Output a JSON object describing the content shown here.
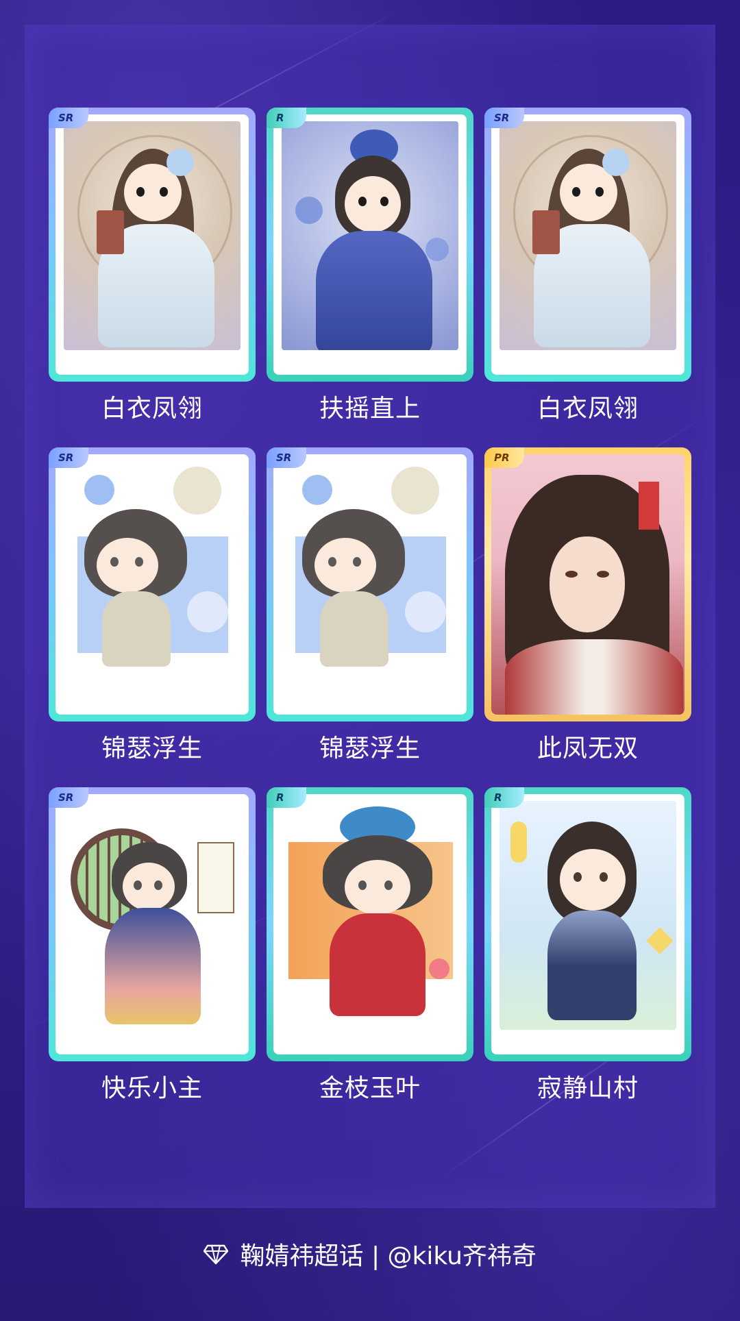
{
  "cards": [
    {
      "rarity": "SR",
      "name": "白衣凤翎",
      "frame": "sr"
    },
    {
      "rarity": "R",
      "name": "扶摇直上",
      "frame": "r"
    },
    {
      "rarity": "SR",
      "name": "白衣凤翎",
      "frame": "sr"
    },
    {
      "rarity": "SR",
      "name": "锦瑟浮生",
      "frame": "sr"
    },
    {
      "rarity": "SR",
      "name": "锦瑟浮生",
      "frame": "sr"
    },
    {
      "rarity": "PR",
      "name": "此凤无双",
      "frame": "pr"
    },
    {
      "rarity": "SR",
      "name": "快乐小主",
      "frame": "sr"
    },
    {
      "rarity": "R",
      "name": "金枝玉叶",
      "frame": "r"
    },
    {
      "rarity": "R",
      "name": "寂静山村",
      "frame": "r"
    }
  ],
  "footer": {
    "icon": "diamond-icon",
    "text": "鞠婧祎超话 | @kiku齐祎奇"
  },
  "colors": {
    "background": "#2c1f7e",
    "panel": "#4630af",
    "sr_frame": "#7fc4ff",
    "r_frame": "#4fd9c6",
    "pr_frame": "#ffd36a"
  }
}
